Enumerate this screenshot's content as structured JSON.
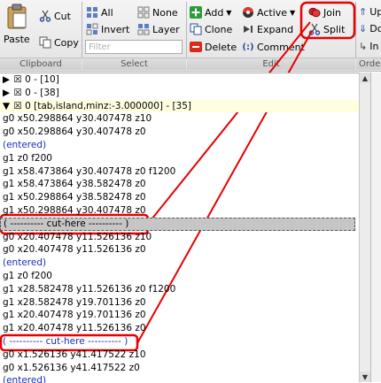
{
  "ribbon": {
    "clipboard": {
      "label": "Clipboard",
      "paste": "Paste",
      "cut": "Cut",
      "copy": "Copy"
    },
    "select": {
      "label": "Select",
      "all": "All",
      "none": "None",
      "invert": "Invert",
      "layer": "Layer",
      "filter_placeholder": "Filter"
    },
    "edit": {
      "label": "Edit",
      "add": "Add",
      "active": "Active",
      "join": "Join",
      "clone": "Clone",
      "expand": "Expand",
      "split": "Split",
      "delete": "Delete",
      "comment": "Comment"
    },
    "order": {
      "label": "Orde",
      "up": "Up",
      "down": "Do",
      "insert": "In"
    }
  },
  "colors": {
    "accent": "#e60000",
    "selected_row": "#ffffe0",
    "blue_text": "#1a2fb8"
  },
  "list": [
    {
      "text": "0 - [10]",
      "kind": "hdr",
      "toggle": "▶"
    },
    {
      "text": "0 - [38]",
      "kind": "hdr",
      "toggle": "▶"
    },
    {
      "text": "0 [tab,island,minz:-3.000000] - [35]",
      "kind": "sel",
      "toggle": "▼"
    },
    {
      "text": "g0 x50.298864 y30.407478 z10",
      "kind": "code"
    },
    {
      "text": "g0 x50.298864 y30.407478 z0",
      "kind": "code"
    },
    {
      "text": "(entered)",
      "kind": "blue"
    },
    {
      "text": "g1 z0 f200",
      "kind": "code"
    },
    {
      "text": "g1 x58.473864 y30.407478 z0 f1200",
      "kind": "code"
    },
    {
      "text": "g1 x58.473864 y38.582478 z0",
      "kind": "code"
    },
    {
      "text": "g1 x50.298864 y38.582478 z0",
      "kind": "code"
    },
    {
      "text": "g1 x50.298864 y30.407478 z0",
      "kind": "code"
    },
    {
      "text": "( ---------- cut-here ---------- )",
      "kind": "cut-sel"
    },
    {
      "text": "g0 x20.407478 y11.526136 z10",
      "kind": "code"
    },
    {
      "text": "g0 x20.407478 y11.526136 z0",
      "kind": "code"
    },
    {
      "text": "(entered)",
      "kind": "blue"
    },
    {
      "text": "g1 z0 f200",
      "kind": "code"
    },
    {
      "text": "g1 x28.582478 y11.526136 z0 f1200",
      "kind": "code"
    },
    {
      "text": "g1 x28.582478 y19.701136 z0",
      "kind": "code"
    },
    {
      "text": "g1 x20.407478 y19.701136 z0",
      "kind": "code"
    },
    {
      "text": "g1 x20.407478 y11.526136 z0",
      "kind": "code"
    },
    {
      "text": "( ---------- cut-here ---------- )",
      "kind": "blue"
    },
    {
      "text": "g0 x1.526136 y41.417522 z10",
      "kind": "code"
    },
    {
      "text": "g0 x1.526136 y41.417522 z0",
      "kind": "code"
    },
    {
      "text": "(entered)",
      "kind": "blue"
    }
  ]
}
